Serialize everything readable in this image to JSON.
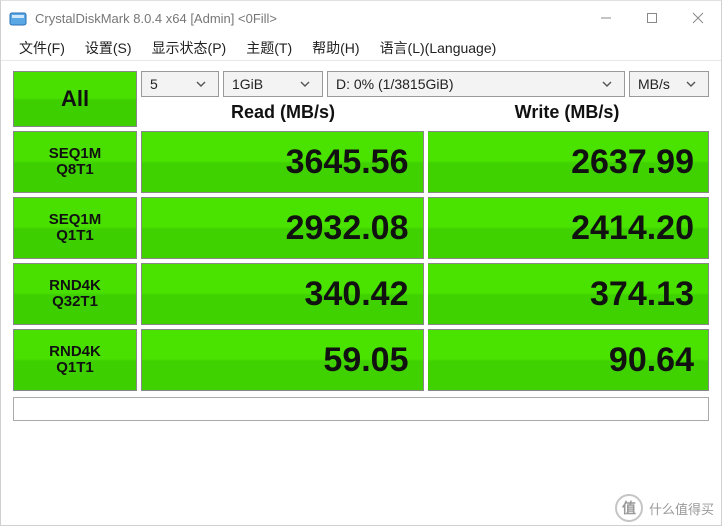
{
  "window": {
    "title": "CrystalDiskMark 8.0.4 x64 [Admin] <0Fill>"
  },
  "menu": {
    "file": "文件(F)",
    "settings": "设置(S)",
    "displayState": "显示状态(P)",
    "theme": "主题(T)",
    "help": "帮助(H)",
    "language": "语言(L)(Language)"
  },
  "controls": {
    "all_label": "All",
    "count": "5",
    "size": "1GiB",
    "drive": "D: 0% (1/3815GiB)",
    "unit": "MB/s"
  },
  "headers": {
    "read": "Read (MB/s)",
    "write": "Write (MB/s)"
  },
  "tests": [
    {
      "line1": "SEQ1M",
      "line2": "Q8T1",
      "read": "3645.56",
      "write": "2637.99"
    },
    {
      "line1": "SEQ1M",
      "line2": "Q1T1",
      "read": "2932.08",
      "write": "2414.20"
    },
    {
      "line1": "RND4K",
      "line2": "Q32T1",
      "read": "340.42",
      "write": "374.13"
    },
    {
      "line1": "RND4K",
      "line2": "Q1T1",
      "read": "59.05",
      "write": "90.64"
    }
  ],
  "watermark": {
    "badge": "值",
    "text": "什么值得买"
  }
}
